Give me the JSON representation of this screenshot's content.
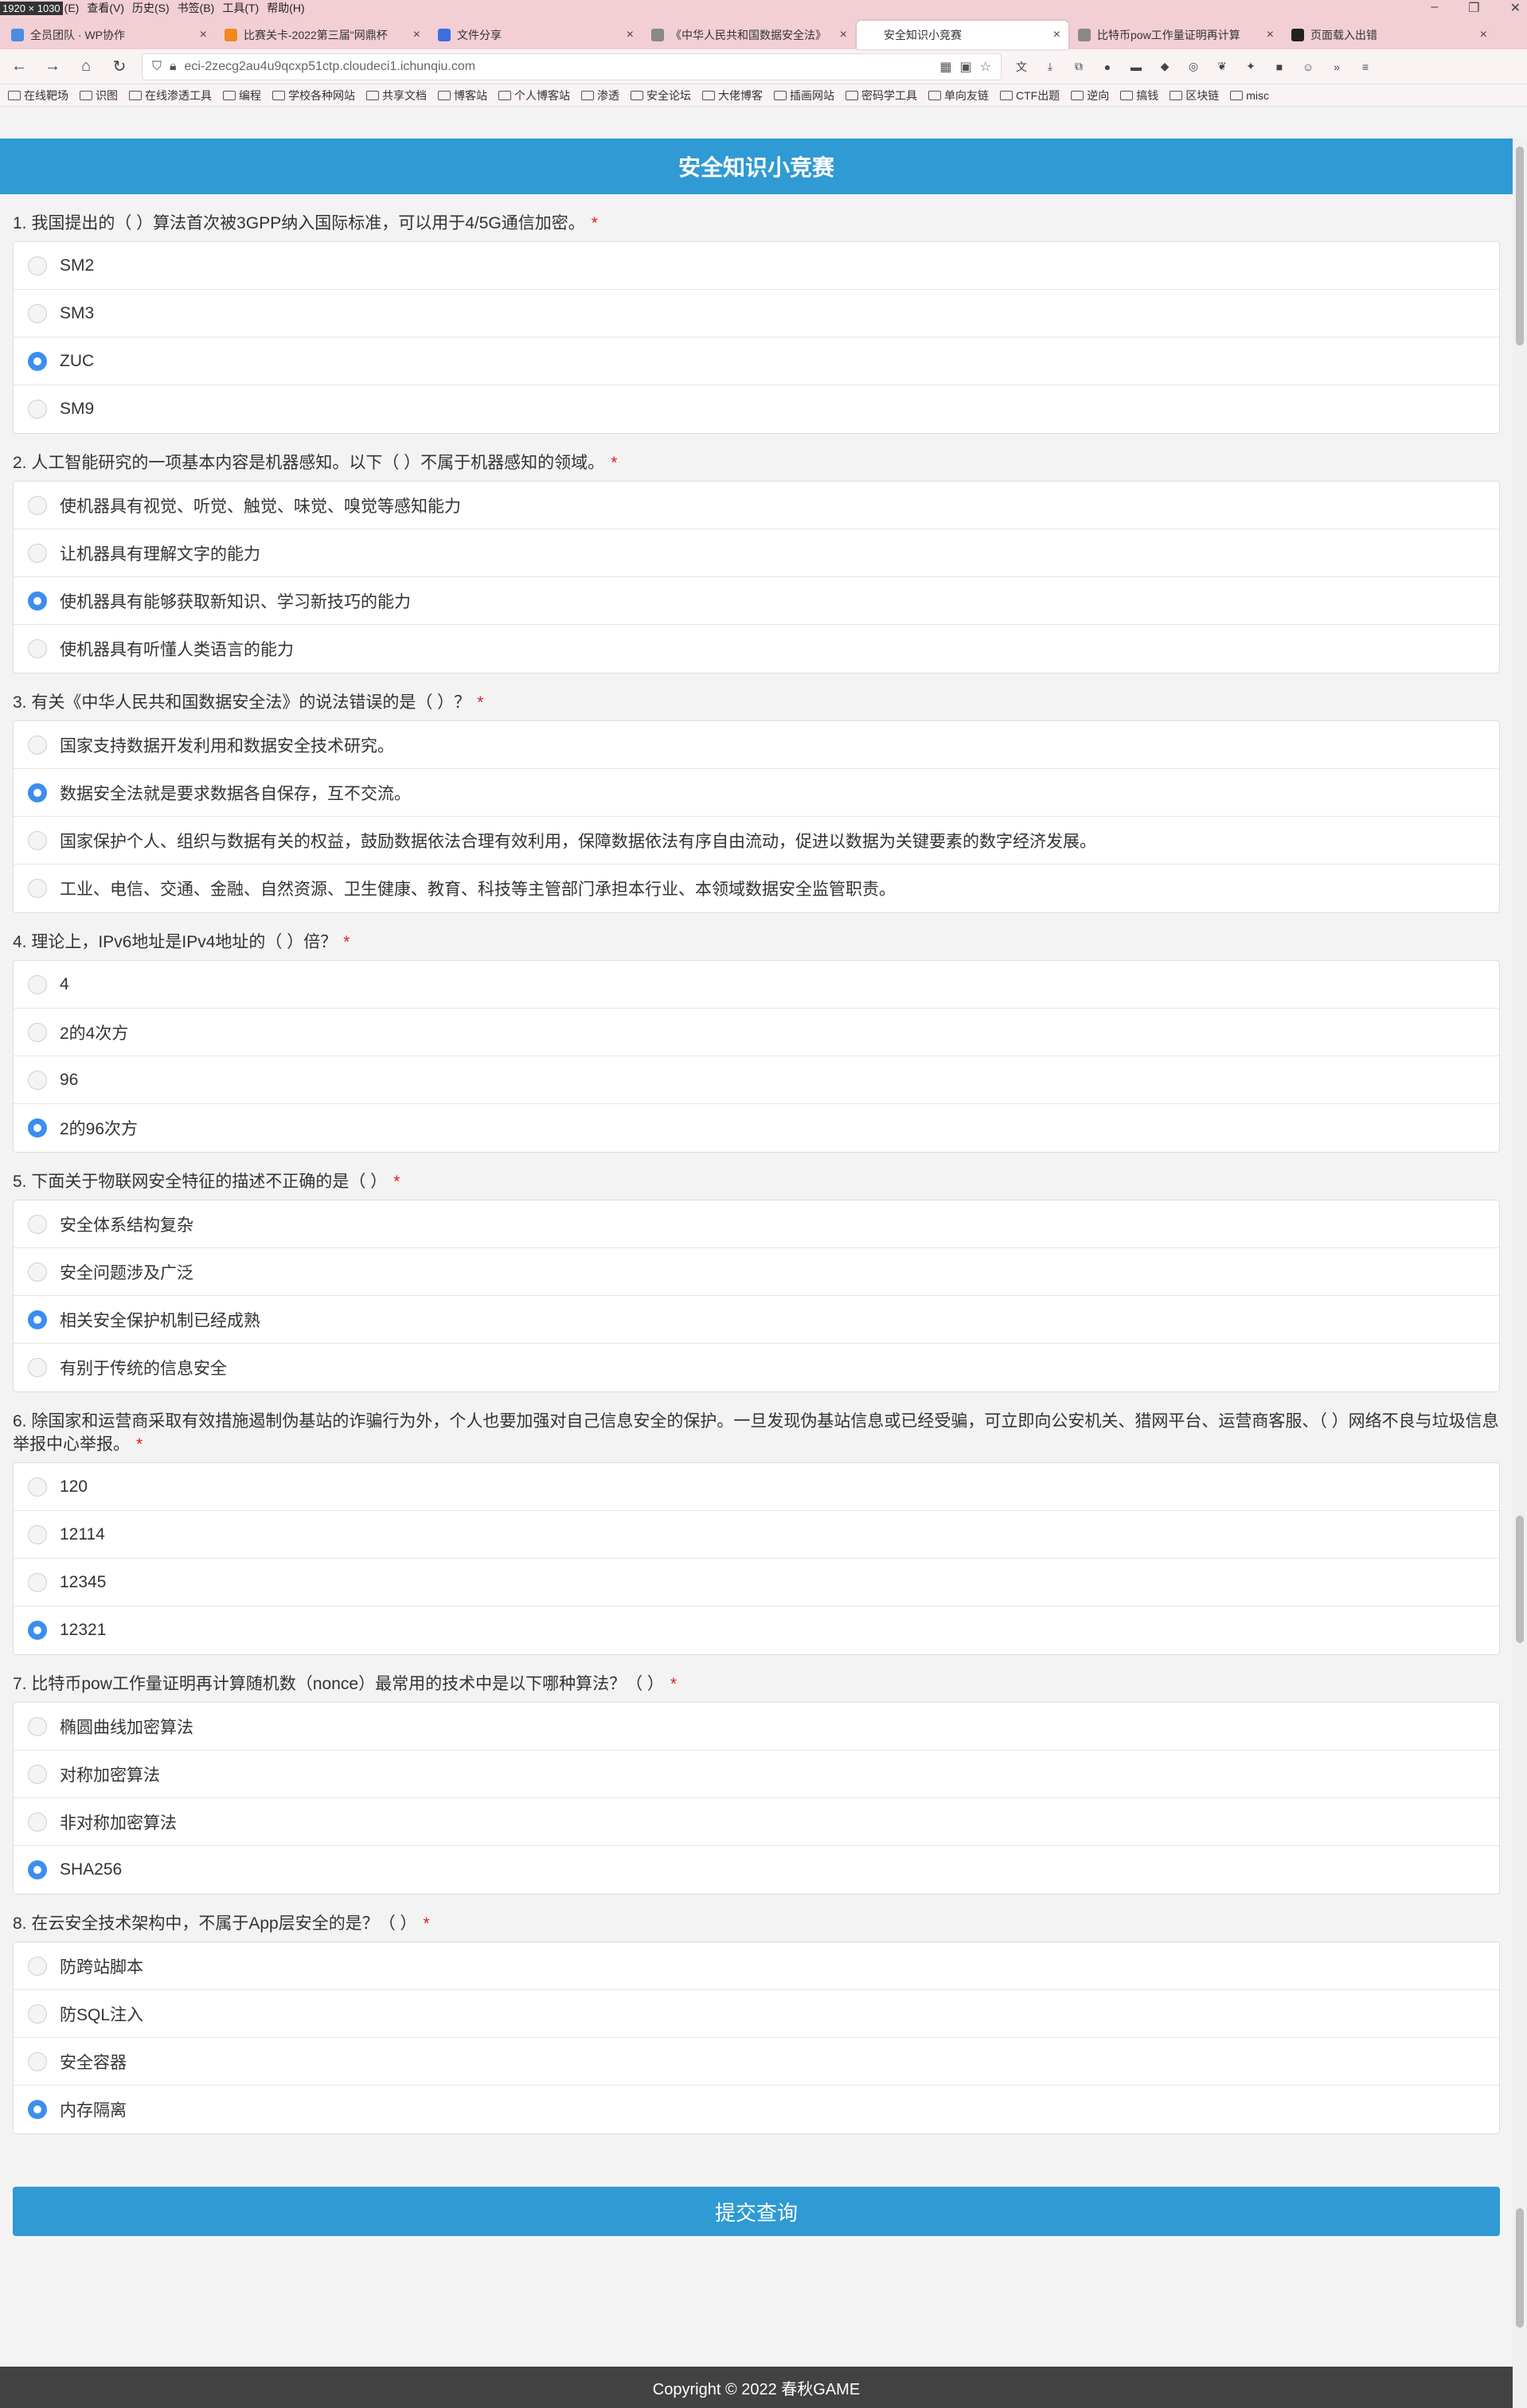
{
  "menubar": {
    "dim_label": "1920 × 1030",
    "items": [
      "(E)",
      "查看(V)",
      "历史(S)",
      "书签(B)",
      "工具(T)",
      "帮助(H)"
    ]
  },
  "tabs": [
    {
      "label": "全员团队 · WP协作",
      "color": "#4a8de0"
    },
    {
      "label": "比赛关卡-2022第三届\"网鼎杯",
      "color": "#f08a1e"
    },
    {
      "label": "文件分享",
      "color": "#3b6fe0"
    },
    {
      "label": "《中华人民共和国数据安全法》",
      "color": "#888888"
    },
    {
      "label": "安全知识小竞赛",
      "color": "#ffffff",
      "active": true
    },
    {
      "label": "比特币pow工作量证明再计算",
      "color": "#888888"
    },
    {
      "label": "页面载入出错",
      "color": "#222222"
    }
  ],
  "navbar": {
    "url": "eci-2zecg2au4u9qcxp51ctp.cloudeci1.ichunqiu.com"
  },
  "bookmarks": [
    "在线靶场",
    "识图",
    "在线渗透工具",
    "编程",
    "学校各种网站",
    "共享文档",
    "博客站",
    "个人博客站",
    "渗透",
    "安全论坛",
    "大佬博客",
    "插画网站",
    "密码学工具",
    "单向友链",
    "CTF出题",
    "逆向",
    "搞钱",
    "区块链",
    "misc"
  ],
  "header": {
    "title": "安全知识小竞赛"
  },
  "questions": [
    {
      "title": "1. 我国提出的（ ）算法首次被3GPP纳入国际标准，可以用于4/5G通信加密。",
      "options": [
        "SM2",
        "SM3",
        "ZUC",
        "SM9"
      ],
      "selected": 2
    },
    {
      "title": "2. 人工智能研究的一项基本内容是机器感知。以下（ ）不属于机器感知的领域。",
      "options": [
        "使机器具有视觉、听觉、触觉、味觉、嗅觉等感知能力",
        "让机器具有理解文字的能力",
        "使机器具有能够获取新知识、学习新技巧的能力",
        "使机器具有听懂人类语言的能力"
      ],
      "selected": 2
    },
    {
      "title": "3. 有关《中华人民共和国数据安全法》的说法错误的是（ ）？",
      "options": [
        "国家支持数据开发利用和数据安全技术研究。",
        "数据安全法就是要求数据各自保存，互不交流。",
        "国家保护个人、组织与数据有关的权益，鼓励数据依法合理有效利用，保障数据依法有序自由流动，促进以数据为关键要素的数字经济发展。",
        "工业、电信、交通、金融、自然资源、卫生健康、教育、科技等主管部门承担本行业、本领域数据安全监管职责。"
      ],
      "selected": 1
    },
    {
      "title": "4. 理论上，IPv6地址是IPv4地址的（ ）倍？",
      "options": [
        "4",
        "2的4次方",
        "96",
        "2的96次方"
      ],
      "selected": 3
    },
    {
      "title": "5. 下面关于物联网安全特征的描述不正确的是（ ）",
      "options": [
        "安全体系结构复杂",
        "安全问题涉及广泛",
        "相关安全保护机制已经成熟",
        "有别于传统的信息安全"
      ],
      "selected": 2
    },
    {
      "title": "6. 除国家和运营商采取有效措施遏制伪基站的诈骗行为外，个人也要加强对自己信息安全的保护。一旦发现伪基站信息或已经受骗，可立即向公安机关、猎网平台、运营商客服、（ ）网络不良与垃圾信息举报中心举报。",
      "options": [
        "120",
        "12114",
        "12345",
        "12321"
      ],
      "selected": 3
    },
    {
      "title": "7. 比特币pow工作量证明再计算随机数（nonce）最常用的技术中是以下哪种算法？（ ）",
      "options": [
        "椭圆曲线加密算法",
        "对称加密算法",
        "非对称加密算法",
        "SHA256"
      ],
      "selected": 3
    },
    {
      "title": "8. 在云安全技术架构中，不属于App层安全的是？（ ）",
      "options": [
        "防跨站脚本",
        "防SQL注入",
        "安全容器",
        "内存隔离"
      ],
      "selected": 3
    }
  ],
  "required_mark": "*",
  "submit": {
    "label": "提交查询"
  },
  "footer": {
    "text": "Copyright © 2022 春秋GAME"
  },
  "colors": {
    "header": "#2f9ad3",
    "radio_on": "#3b8ef0",
    "footer": "#424242",
    "chrome": "#f2cfd4"
  }
}
